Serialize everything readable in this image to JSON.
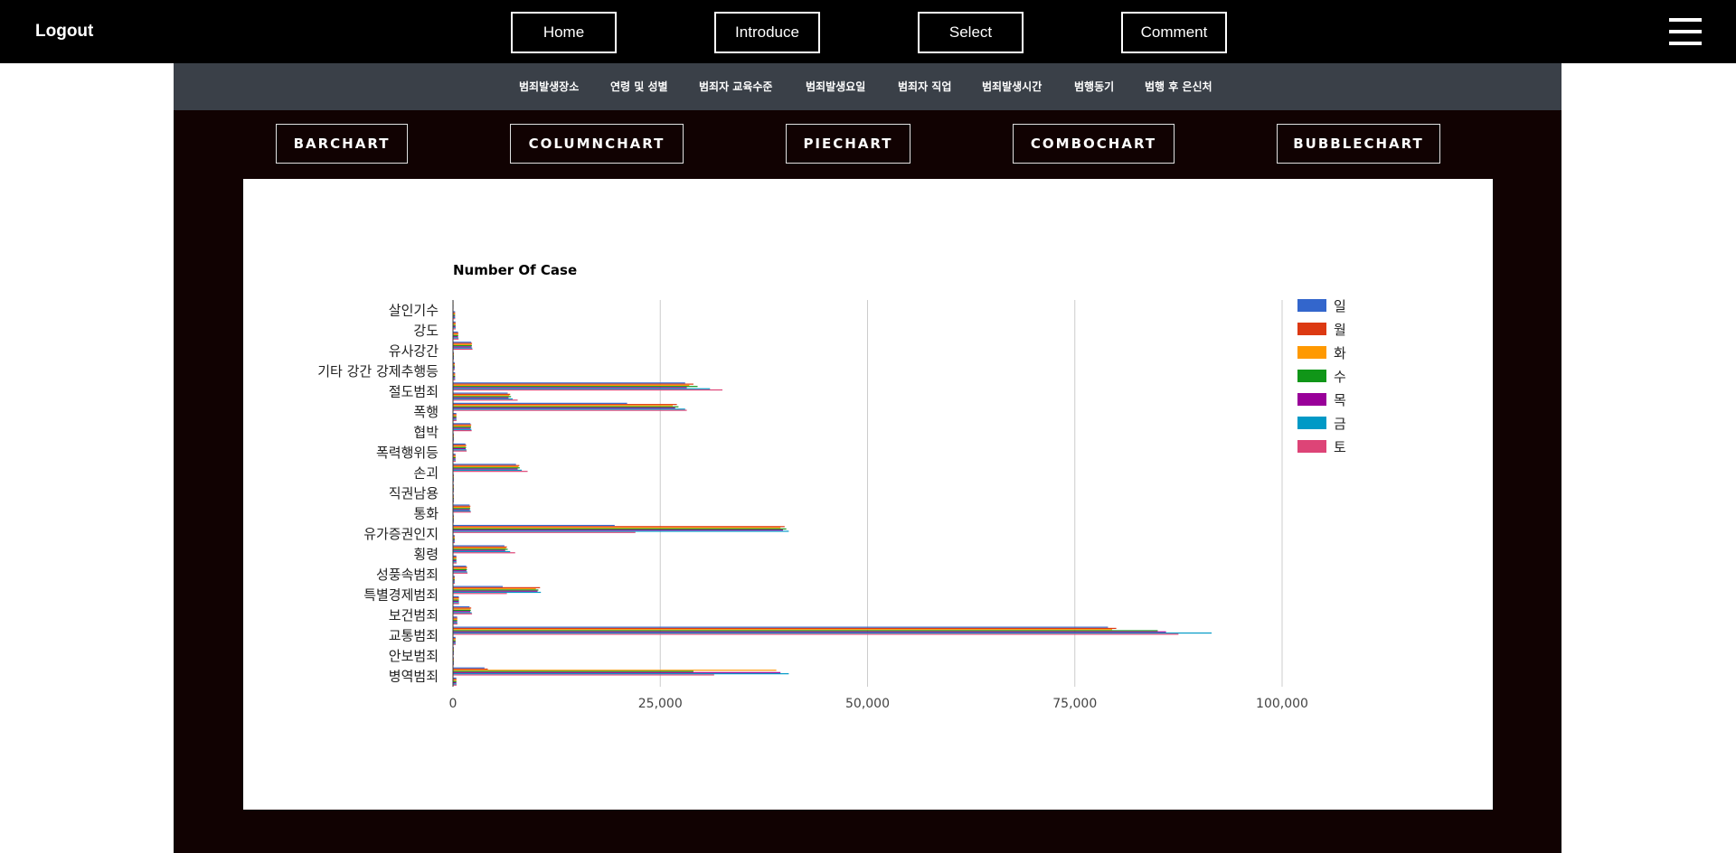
{
  "topnav": {
    "logout": "Logout",
    "buttons": [
      "Home",
      "Introduce",
      "Select",
      "Comment"
    ],
    "menu_icon": "hamburger-menu-icon"
  },
  "subnav": {
    "items": [
      "범죄발생장소",
      "연령 및 성별",
      "범죄자 교육수준",
      "범죄발생요일",
      "범죄자 직업",
      "범죄발생시간",
      "범행동기",
      "범행 후 은신처"
    ]
  },
  "chart_buttons": [
    "BARCHART",
    "COLUMNCHART",
    "PIECHART",
    "COMBOCHART",
    "BUBBLECHART"
  ],
  "chart_data": {
    "type": "bar",
    "orientation": "horizontal",
    "title": "Number Of Case",
    "xlim": [
      0,
      100000
    ],
    "xticks": [
      "0",
      "25,000",
      "50,000",
      "75,000",
      "100,000"
    ],
    "grid": true,
    "legend_position": "right",
    "categories": [
      "살인기수",
      "",
      "강도",
      "",
      "유사강간",
      "",
      "기타 강간 강제추행등",
      "",
      "절도범죄",
      "",
      "폭행",
      "",
      "협박",
      "",
      "폭력행위등",
      "",
      "손괴",
      "",
      "직권남용",
      "",
      "통화",
      "",
      "유가증권인지",
      "",
      "횡령",
      "",
      "성풍속범죄",
      "",
      "특별경제범죄",
      "",
      "보건범죄",
      "",
      "교통범죄",
      "",
      "안보범죄",
      "",
      "병역범죄",
      ""
    ],
    "series": [
      {
        "name": "일",
        "color": "#3366cc",
        "values": [
          50,
          250,
          300,
          600,
          2200,
          100,
          200,
          250,
          28000,
          6600,
          21000,
          400,
          2100,
          100,
          1500,
          300,
          7600,
          100,
          100,
          100,
          2000,
          100,
          19500,
          200,
          6200,
          400,
          1600,
          200,
          6000,
          700,
          2000,
          500,
          79000,
          300,
          100,
          100,
          3800,
          400
        ]
      },
      {
        "name": "월",
        "color": "#dc3912",
        "values": [
          55,
          260,
          320,
          650,
          2300,
          110,
          210,
          260,
          29000,
          6900,
          27000,
          420,
          2200,
          105,
          1600,
          320,
          8000,
          105,
          105,
          105,
          2100,
          105,
          40000,
          210,
          6500,
          420,
          1700,
          210,
          10500,
          720,
          2200,
          520,
          80000,
          320,
          105,
          105,
          4200,
          420
        ]
      },
      {
        "name": "화",
        "color": "#ff9900",
        "values": [
          52,
          255,
          310,
          620,
          2250,
          105,
          205,
          255,
          28500,
          6800,
          26500,
          410,
          2150,
          102,
          1550,
          310,
          7900,
          102,
          102,
          102,
          2050,
          102,
          39500,
          205,
          6400,
          410,
          1650,
          205,
          10000,
          710,
          2100,
          510,
          79500,
          310,
          102,
          102,
          39000,
          410
        ]
      },
      {
        "name": "수",
        "color": "#109618",
        "values": [
          53,
          258,
          315,
          630,
          2280,
          108,
          208,
          258,
          29500,
          7000,
          27200,
          415,
          2180,
          103,
          1580,
          315,
          8050,
          103,
          103,
          103,
          2080,
          103,
          40200,
          208,
          6600,
          415,
          1680,
          208,
          10300,
          715,
          2150,
          515,
          85000,
          315,
          103,
          103,
          29000,
          415
        ]
      },
      {
        "name": "목",
        "color": "#990099",
        "values": [
          51,
          252,
          305,
          610,
          2230,
          103,
          203,
          252,
          28200,
          6700,
          26800,
          405,
          2120,
          101,
          1530,
          305,
          7800,
          101,
          101,
          101,
          2020,
          101,
          39800,
          203,
          6300,
          405,
          1620,
          203,
          10200,
          705,
          2080,
          505,
          86000,
          305,
          101,
          101,
          39500,
          405
        ]
      },
      {
        "name": "금",
        "color": "#0099c6",
        "values": [
          54,
          262,
          325,
          660,
          2320,
          112,
          212,
          262,
          31000,
          7200,
          28000,
          425,
          2220,
          106,
          1620,
          325,
          8300,
          106,
          106,
          106,
          2120,
          106,
          40500,
          212,
          6900,
          425,
          1720,
          212,
          10600,
          725,
          2250,
          525,
          91500,
          325,
          106,
          106,
          40500,
          425
        ]
      },
      {
        "name": "토",
        "color": "#dd4477",
        "values": [
          56,
          265,
          330,
          680,
          2350,
          115,
          215,
          265,
          32500,
          7800,
          28200,
          430,
          2250,
          108,
          1650,
          330,
          9000,
          108,
          108,
          108,
          2150,
          108,
          22000,
          215,
          7500,
          430,
          1750,
          215,
          6500,
          730,
          2300,
          530,
          87500,
          330,
          108,
          108,
          31500,
          430
        ]
      }
    ]
  }
}
